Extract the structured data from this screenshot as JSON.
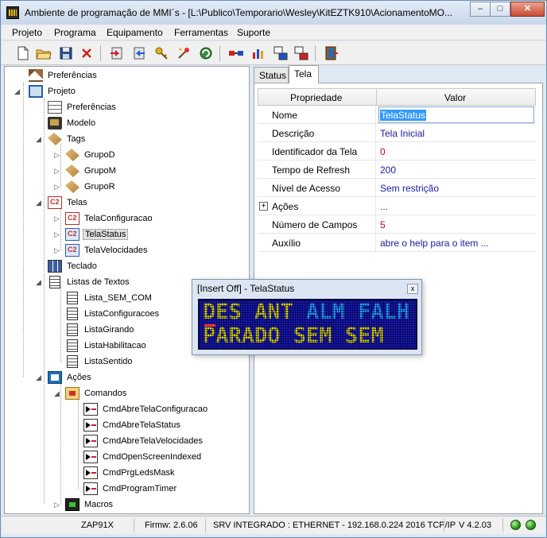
{
  "window": {
    "title": "Ambiente de programação de MMI´s - [L:\\Publico\\Temporario\\Wesley\\KitEZTK910\\AcionamentoMO...",
    "minimize": "–",
    "maximize": "□",
    "close": "✕"
  },
  "menu": [
    "Projeto",
    "Programa",
    "Equipamento",
    "Ferramentas",
    "Suporte"
  ],
  "toolbar": {
    "icons": [
      "new-file-icon",
      "open-folder-icon",
      "save-icon",
      "delete-icon",
      "download-icon",
      "upload-icon",
      "key-icon",
      "star-tool-icon",
      "refresh-icon",
      "connect-icon",
      "config-icon",
      "transfer-icon",
      "transfer2-icon",
      "exit-icon"
    ]
  },
  "tree": {
    "root_prefs": "Preferências",
    "project": "Projeto",
    "prefs": "Preferências",
    "model": "Modelo",
    "tags": "Tags",
    "tag_groups": [
      "GrupoD",
      "GrupoM",
      "GrupoR"
    ],
    "screens": "Telas",
    "screen_items": [
      "TelaConfiguracao",
      "TelaStatus",
      "TelaVelocidades"
    ],
    "keyboard": "Teclado",
    "text_lists": "Listas de Textos",
    "text_list_items": [
      "Lista_SEM_COM",
      "ListaConfiguracoes",
      "ListaGirando",
      "ListaHabilitacao",
      "ListaSentido"
    ],
    "actions": "Ações",
    "commands": "Comandos",
    "command_items": [
      "CmdAbreTelaConfiguracao",
      "CmdAbreTelaStatus",
      "CmdAbreTelaVelocidades",
      "CmdOpenScreenIndexed",
      "CmdPrgLedsMask",
      "CmdProgramTimer"
    ],
    "macros": "Macros"
  },
  "tabs": [
    "Status",
    "Tela"
  ],
  "properties": {
    "header": {
      "property": "Propriedade",
      "value": "Valor"
    },
    "rows": [
      {
        "key": "Nome",
        "value": "TelaStatus"
      },
      {
        "key": "Descrição",
        "value": "Tela Inicial"
      },
      {
        "key": "Identificador da Tela",
        "value": "0"
      },
      {
        "key": "Tempo de Refresh",
        "value": "200"
      },
      {
        "key": "Nível de Acesso",
        "value": "Sem restrição"
      },
      {
        "key": "Ações",
        "value": "..."
      },
      {
        "key": "Número de Campos",
        "value": "5"
      },
      {
        "key": "Auxílio",
        "value": "abre o help para o item ..."
      }
    ]
  },
  "preview": {
    "title": "[Insert Off] - TelaStatus",
    "close": "x",
    "line1": {
      "a": "DES ANT ",
      "b": "ALM FALH"
    },
    "line2": {
      "a": "PARADO",
      "b": " SEM SEM"
    }
  },
  "status": {
    "device": "ZAP91X",
    "firmware": "Firmw: 2.6.06",
    "server": "SRV INTEGRADO : ETHERNET - 192.168.0.224 2016 TCP/IP",
    "version": "V 4.2.03"
  },
  "colors": {
    "lcd_bg": "#1818a8",
    "lcd_text": "#dcd400",
    "lcd_text_alt": "#24a8ff",
    "value_text": "#1a1aa0",
    "number_text": "#b01010"
  }
}
